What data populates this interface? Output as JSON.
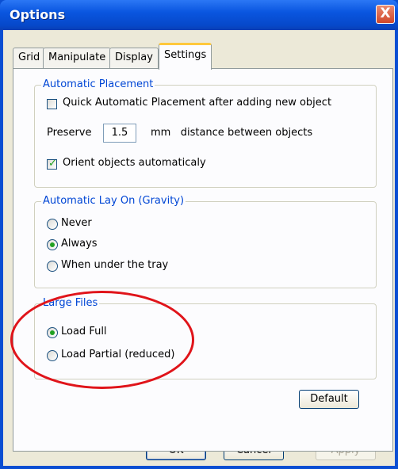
{
  "window": {
    "title": "Options",
    "close_glyph": "X"
  },
  "tabs": [
    {
      "label": "Grid",
      "active": false
    },
    {
      "label": "Manipulate",
      "active": false
    },
    {
      "label": "Display",
      "active": false
    },
    {
      "label": "Settings",
      "active": true
    }
  ],
  "automatic_placement": {
    "legend": "Automatic Placement",
    "quick_label": "Quick Automatic Placement after adding new object",
    "quick_checked": false,
    "preserve_label": "Preserve",
    "preserve_value": "1.5",
    "preserve_suffix": "mm   distance between objects",
    "orient_label": "Orient objects automaticaly",
    "orient_checked": true
  },
  "gravity": {
    "legend": "Automatic Lay On (Gravity)",
    "options": [
      "Never",
      "Always",
      "When under the tray"
    ],
    "selected": "Always"
  },
  "large_files": {
    "legend": "Large Files",
    "options": [
      "Load Full",
      "Load Partial (reduced)"
    ],
    "selected": "Load Full"
  },
  "buttons": {
    "default": "Default",
    "ok": "OK",
    "cancel": "Cancel",
    "apply": "Apply"
  },
  "colors": {
    "title_bar": "#0a56e0",
    "legend_text": "#0046d5",
    "highlight_ellipse": "#e0141a",
    "check_mark": "#21a121"
  }
}
